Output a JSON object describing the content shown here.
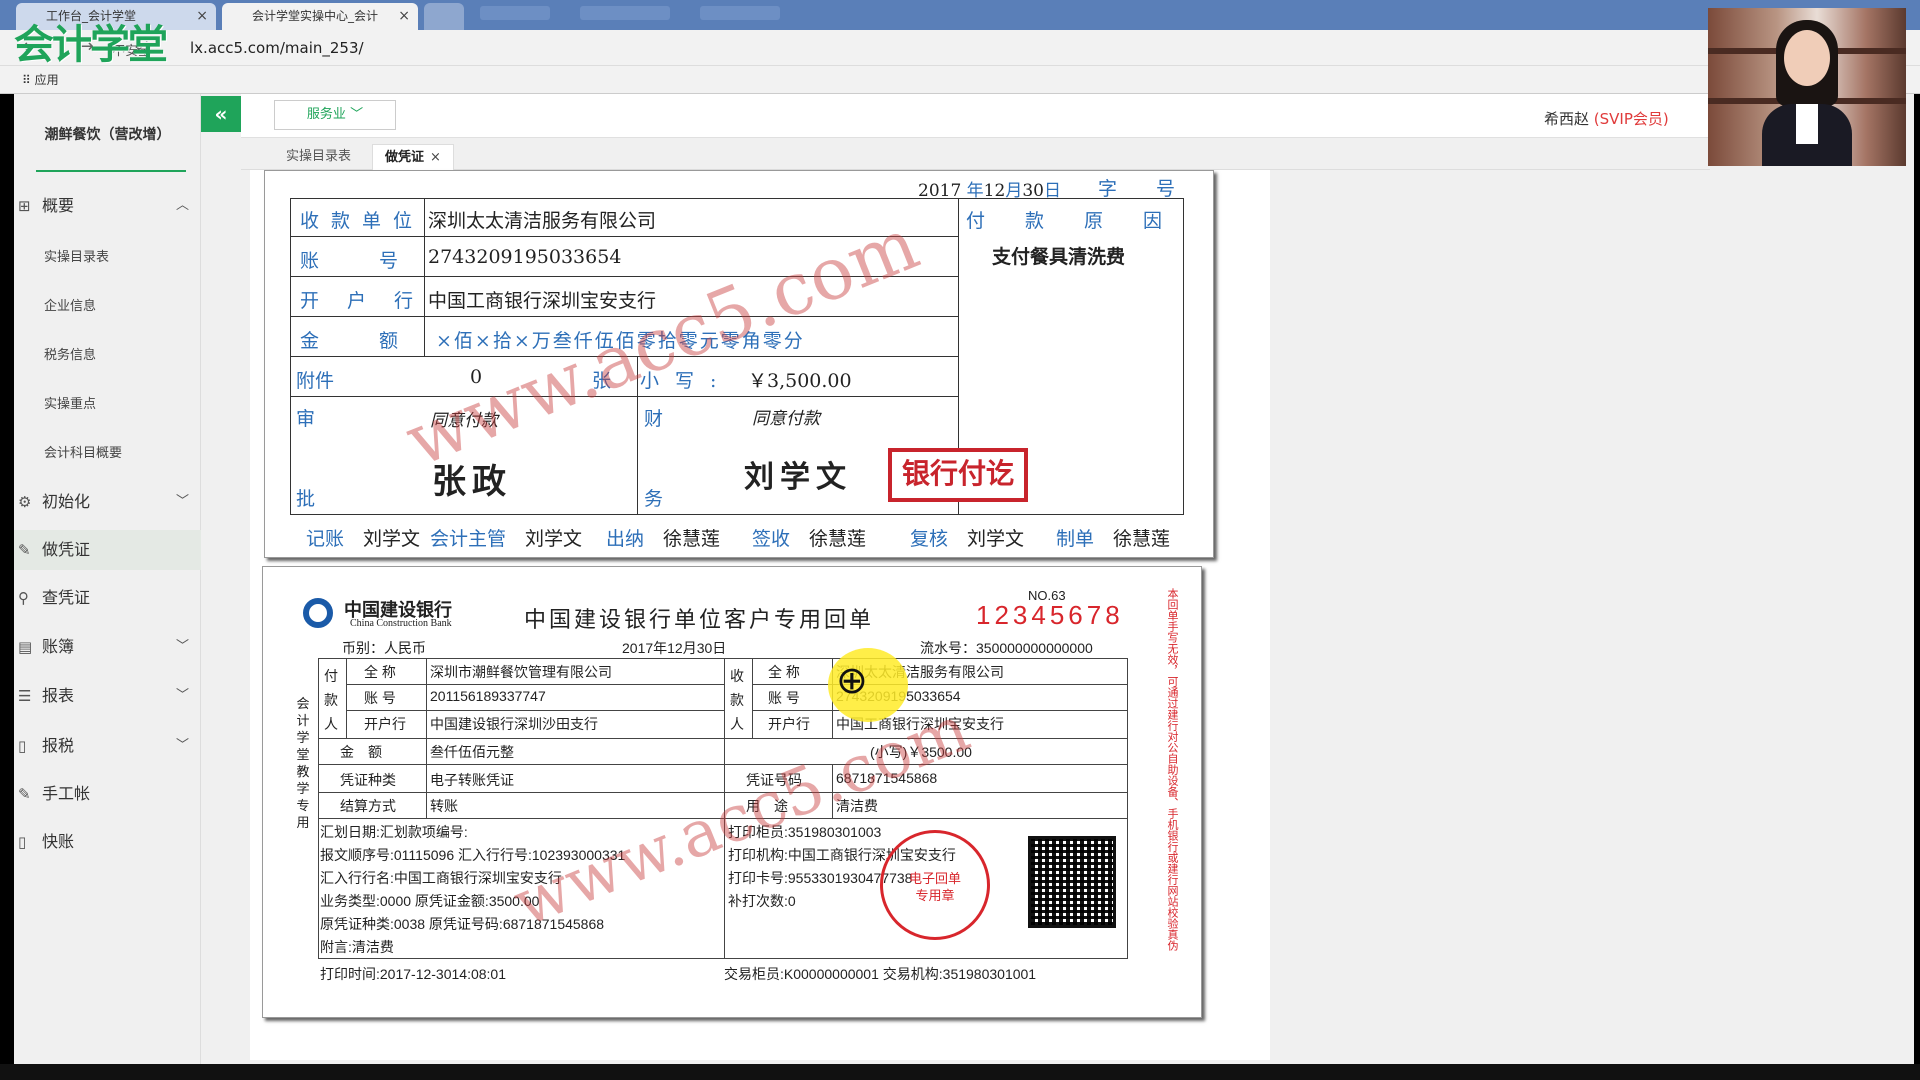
{
  "browser": {
    "tabs": [
      {
        "label": "工作台_会计学堂"
      },
      {
        "label": "会计学堂实操中心_会计"
      }
    ],
    "url": "lx.acc5.com/main_253/",
    "security": "不安全",
    "bookmarks_apps": "应用"
  },
  "brand": {
    "logo_text": "会计学堂",
    "accent": "#1fa45a"
  },
  "header": {
    "industry_button": "服务业",
    "user_name": "希西赵",
    "user_level": "(SVIP会员)"
  },
  "page_tabs": [
    {
      "label": "实操目录表"
    },
    {
      "label": "做凭证"
    }
  ],
  "sidebar": {
    "company": "潮鲜餐饮（营改增）",
    "groups": [
      {
        "label": "概要",
        "icon": "grid-icon"
      },
      {
        "label": "初始化",
        "icon": "gear-icon"
      },
      {
        "label": "做凭证",
        "icon": "pen-icon"
      },
      {
        "label": "查凭证",
        "icon": "search-icon"
      },
      {
        "label": "账簿",
        "icon": "book-icon"
      },
      {
        "label": "报表",
        "icon": "report-icon"
      },
      {
        "label": "报税",
        "icon": "file-icon"
      },
      {
        "label": "手工帐",
        "icon": "pen-icon"
      },
      {
        "label": "快账",
        "icon": "file-icon"
      }
    ],
    "sub_items": [
      "实操目录表",
      "企业信息",
      "税务信息",
      "实操重点",
      "会计科目概要"
    ]
  },
  "voucher": {
    "date_year": "2017",
    "date_year_unit": "年",
    "date_month": "12",
    "date_month_unit": "月",
    "date_day": "30",
    "date_day_unit": "日",
    "zi": "字",
    "hao": "号",
    "labels": {
      "payee": "收款单位",
      "account": "账号",
      "bank": "开户行",
      "amount": "金额",
      "attachment": "附件",
      "zhang": "张",
      "small_write": "小写:",
      "shen": "审",
      "pi": "批",
      "cai": "财",
      "wu": "务",
      "reason": "付款原因"
    },
    "payee": "深圳太太清洁服务有限公司",
    "account": "2743209195033654",
    "bank": "中国工商银行深圳宝安支行",
    "amount_digits": "×佰×拾×万叁仟伍佰零拾零元零角零分",
    "attachment_count": "0",
    "amount_small": "￥3,500.00",
    "approve_note_1": "同意付款",
    "approve_note_2": "同意付款",
    "approver": "张政",
    "finance_signer": "刘学文",
    "reason": "支付餐具清洗费",
    "stamp": "银行付讫",
    "footer": [
      {
        "label": "记账",
        "name": "刘学文"
      },
      {
        "label": "会计主管",
        "name": "刘学文"
      },
      {
        "label": "出纳",
        "name": "徐慧莲"
      },
      {
        "label": "签收",
        "name": "徐慧莲"
      },
      {
        "label": "复核",
        "name": "刘学文"
      },
      {
        "label": "制单",
        "name": "徐慧莲"
      }
    ]
  },
  "watermark": "www.acc5.com",
  "receipt": {
    "bank_name_cn": "中国建设银行",
    "bank_name_en": "China Construction Bank",
    "title": "中国建设银行单位客户专用回单",
    "no_label": "NO.63",
    "serial": "12345678",
    "currency": "币别：人民币",
    "date": "2017年12月30日",
    "flow_no": "流水号：350000000000000",
    "payer_label": [
      "付",
      "款",
      "人"
    ],
    "payee_label": [
      "收",
      "款",
      "人"
    ],
    "full_name_label": "全 称",
    "account_label": "账 号",
    "bank_label": "开户行",
    "payer_name": "深圳市潮鲜餐饮管理有限公司",
    "payer_account": "201156189337747",
    "payer_bank": "中国建设银行深圳沙田支行",
    "payee_name": "深圳太太清洁服务有限公司",
    "payee_account": "2743209195033654",
    "payee_bank": "中国工商银行深圳宝安支行",
    "amount_label": "金　额",
    "amount_big": "叁仟伍佰元整",
    "amount_small": "(小写)￥3500.00",
    "voucher_type_label": "凭证种类",
    "voucher_type": "电子转账凭证",
    "voucher_no_label": "凭证号码",
    "voucher_no": "6871871545868",
    "settle_label": "结算方式",
    "settle": "转账",
    "purpose_label": "用　途",
    "purpose": "清洁费",
    "details_left": [
      "汇划日期:汇划款项编号:",
      "报文顺序号:01115096 汇入行行号:102393000331",
      "汇入行行名:中国工商银行深圳宝安支行",
      "业务类型:0000 原凭证金额:3500.00",
      "原凭证种类:0038 原凭证号码:6871871545868",
      "附言:清洁费"
    ],
    "details_right": [
      "打印柜员:351980301003",
      "打印机构:中国工商银行深圳宝安支行",
      "打印卡号:9553301930477738",
      "补打次数:0"
    ],
    "seal_text": "电子回单专用章",
    "print_time": "打印时间:2017-12-3014:08:01",
    "counter_info": "交易柜员:K00000000001 交易机构:351980301001",
    "left_note": "会计学堂教学专用",
    "side_note": "本回单手写无效，可通过建行对公自助设备、手机银行或建行网站校验真伪"
  }
}
